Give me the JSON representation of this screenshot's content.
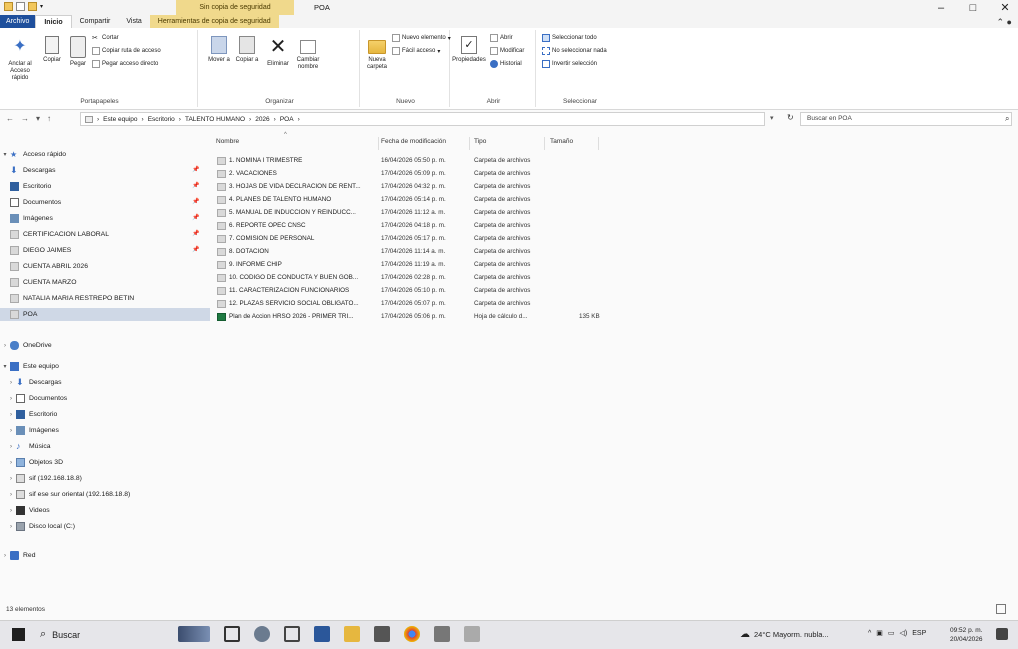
{
  "window": {
    "context_tab": "Sin copia de seguridad",
    "title": "POA",
    "controls": [
      "–",
      "□",
      "✕"
    ]
  },
  "ribbon_tabs": [
    "Archivo",
    "Inicio",
    "Compartir",
    "Vista",
    "Herramientas de copia de seguridad"
  ],
  "ribbon": {
    "portapapeles": {
      "label": "Portapapeles",
      "anclar": "Anclar al Acceso rápido",
      "copiar": "Copiar",
      "pegar": "Pegar",
      "cortar": "Cortar",
      "copiar_ruta": "Copiar ruta de acceso",
      "pegar_acceso": "Pegar acceso directo"
    },
    "organizar": {
      "label": "Organizar",
      "mover": "Mover a",
      "copiar": "Copiar a",
      "eliminar": "Eliminar",
      "cambiar": "Cambiar nombre"
    },
    "nuevo": {
      "label": "Nuevo",
      "nueva_carpeta": "Nueva carpeta",
      "nuevo_elemento": "Nuevo elemento",
      "facil_acceso": "Fácil acceso"
    },
    "abrir": {
      "label": "Abrir",
      "propiedades": "Propiedades",
      "abrir": "Abrir",
      "modificar": "Modificar",
      "historial": "Historial"
    },
    "seleccionar": {
      "label": "Seleccionar",
      "todo": "Seleccionar todo",
      "nada": "No seleccionar nada",
      "invertir": "Invertir selección"
    }
  },
  "address": {
    "path": [
      "Este equipo",
      "Escritorio",
      "TALENTO HUMANO",
      "2026",
      "POA"
    ],
    "search_placeholder": "Buscar en POA"
  },
  "nav": {
    "quick_access": "Acceso rápido",
    "quick_items": [
      {
        "label": "Descargas",
        "pinned": true
      },
      {
        "label": "Escritorio",
        "pinned": true
      },
      {
        "label": "Documentos",
        "pinned": true
      },
      {
        "label": "Imágenes",
        "pinned": true
      },
      {
        "label": "CERTIFICACION LABORAL",
        "pinned": true
      },
      {
        "label": "DIEGO JAIMES",
        "pinned": true
      },
      {
        "label": "CUENTA ABRIL 2026",
        "pinned": false
      },
      {
        "label": "CUENTA MARZO",
        "pinned": false
      },
      {
        "label": "NATALIA MARIA RESTREPO BETIN",
        "pinned": false
      },
      {
        "label": "POA",
        "pinned": false
      }
    ],
    "onedrive": "OneDrive",
    "this_pc": "Este equipo",
    "pc_items": [
      "Descargas",
      "Documentos",
      "Escritorio",
      "Imágenes",
      "Música",
      "Objetos 3D",
      "sif (192.168.18.8)",
      "sif ese sur oriental (192.168.18.8)",
      "Videos",
      "Disco local (C:)"
    ],
    "network": "Red"
  },
  "columns": {
    "name": "Nombre",
    "date": "Fecha de modificación",
    "type": "Tipo",
    "size": "Tamaño"
  },
  "files": [
    {
      "name": "1. NOMINA I TRIMESTRE",
      "date": "16/04/2026 05:50 p. m.",
      "type": "Carpeta de archivos",
      "size": ""
    },
    {
      "name": "2. VACACIONES",
      "date": "17/04/2026 05:09 p. m.",
      "type": "Carpeta de archivos",
      "size": ""
    },
    {
      "name": "3. HOJAS DE VIDA DECLRACION DE RENT...",
      "date": "17/04/2026 04:32 p. m.",
      "type": "Carpeta de archivos",
      "size": ""
    },
    {
      "name": "4. PLANES DE TALENTO HUMANO",
      "date": "17/04/2026 05:14 p. m.",
      "type": "Carpeta de archivos",
      "size": ""
    },
    {
      "name": "5. MANUAL DE INDUCCION Y REINDUCC...",
      "date": "17/04/2026 11:12 a. m.",
      "type": "Carpeta de archivos",
      "size": ""
    },
    {
      "name": "6. REPORTE OPEC CNSC",
      "date": "17/04/2026 04:18 p. m.",
      "type": "Carpeta de archivos",
      "size": ""
    },
    {
      "name": "7. COMISION DE PERSONAL",
      "date": "17/04/2026 05:17 p. m.",
      "type": "Carpeta de archivos",
      "size": ""
    },
    {
      "name": "8. DOTACION",
      "date": "17/04/2026 11:14 a. m.",
      "type": "Carpeta de archivos",
      "size": ""
    },
    {
      "name": "9. INFORME CHIP",
      "date": "17/04/2026 11:19 a. m.",
      "type": "Carpeta de archivos",
      "size": ""
    },
    {
      "name": "10. CODIGO DE CONDUCTA Y BUEN GOB...",
      "date": "17/04/2026 02:28 p. m.",
      "type": "Carpeta de archivos",
      "size": ""
    },
    {
      "name": "11. CARACTERIZACION FUNCIONARIOS",
      "date": "17/04/2026 05:10 p. m.",
      "type": "Carpeta de archivos",
      "size": ""
    },
    {
      "name": "12. PLAZAS SERVICIO SOCIAL OBLIGATO...",
      "date": "17/04/2026 05:07 p. m.",
      "type": "Carpeta de archivos",
      "size": ""
    },
    {
      "name": "Plan de Accion HRSO 2026 - PRIMER TRI...",
      "date": "17/04/2026 05:06 p. m.",
      "type": "Hoja de cálculo d...",
      "size": "135 KB"
    }
  ],
  "status": {
    "count": "13 elementos"
  },
  "taskbar": {
    "search": "Buscar",
    "weather": "24°C Mayorm. nubla...",
    "lang": "ESP",
    "time": "09:52 p. m.",
    "date": "20/04/2026"
  },
  "colors": {
    "accent": "#1e4f9c",
    "context": "#f0d98c",
    "selected": "#cfd8e6",
    "folder": "#e6b73f",
    "excel": "#1f7a42"
  }
}
